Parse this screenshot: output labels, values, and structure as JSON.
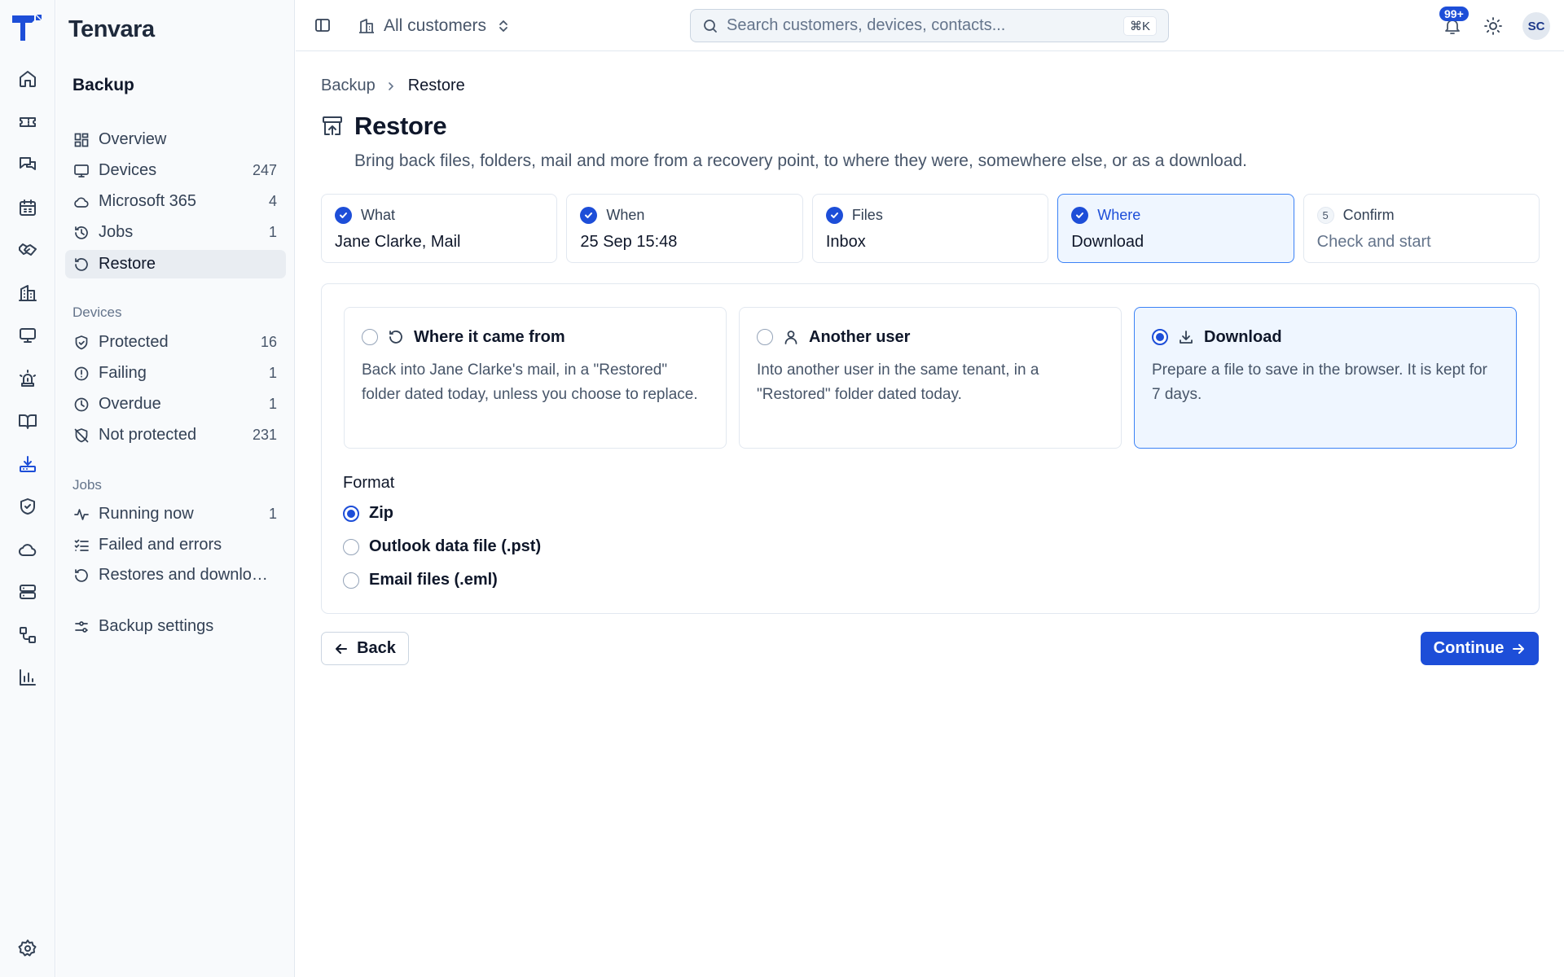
{
  "app": {
    "name": "Tenvara"
  },
  "topbar": {
    "customer_selector": "All customers",
    "search_placeholder": "Search customers, devices, contacts...",
    "search_shortcut": "⌘K",
    "notifications_badge": "99+",
    "avatar_initials": "SC"
  },
  "sidebar": {
    "title": "Backup",
    "items": [
      {
        "label": "Overview",
        "count": "",
        "icon": "overview-icon"
      },
      {
        "label": "Devices",
        "count": "247",
        "icon": "monitor-icon"
      },
      {
        "label": "Microsoft 365",
        "count": "4",
        "icon": "cloud-icon"
      },
      {
        "label": "Jobs",
        "count": "1",
        "icon": "history-icon"
      },
      {
        "label": "Restore",
        "count": "",
        "icon": "restore-icon",
        "active": true
      }
    ],
    "devices_section": {
      "label": "Devices",
      "items": [
        {
          "label": "Protected",
          "count": "16",
          "icon": "shield-check-icon"
        },
        {
          "label": "Failing",
          "count": "1",
          "icon": "alert-circle-icon"
        },
        {
          "label": "Overdue",
          "count": "1",
          "icon": "clock-icon"
        },
        {
          "label": "Not protected",
          "count": "231",
          "icon": "shield-off-icon"
        }
      ]
    },
    "jobs_section": {
      "label": "Jobs",
      "items": [
        {
          "label": "Running now",
          "count": "1",
          "icon": "activity-icon"
        },
        {
          "label": "Failed and errors",
          "count": "",
          "icon": "list-checks-icon"
        },
        {
          "label": "Restores and downloads",
          "count": "",
          "icon": "restore-icon"
        }
      ]
    },
    "settings": {
      "label": "Backup settings",
      "icon": "settings-sliders-icon"
    }
  },
  "breadcrumb": {
    "parent": "Backup",
    "current": "Restore"
  },
  "page": {
    "title": "Restore",
    "description": "Bring back files, folders, mail and more from a recovery point, to where they were, somewhere else, or as a download."
  },
  "steps": [
    {
      "label": "What",
      "value": "Jane Clarke, Mail",
      "state": "done"
    },
    {
      "label": "When",
      "value": "25 Sep 15:48",
      "state": "done"
    },
    {
      "label": "Files",
      "value": "Inbox",
      "state": "done"
    },
    {
      "label": "Where",
      "value": "Download",
      "state": "current"
    },
    {
      "label": "Confirm",
      "value": "Check and start",
      "state": "pending",
      "number": "5"
    }
  ],
  "destinations": [
    {
      "title": "Where it came from",
      "description": "Back into Jane Clarke's mail, in a \"Restored\" folder dated today, unless you choose to replace.",
      "selected": false,
      "icon": "restore-icon"
    },
    {
      "title": "Another user",
      "description": "Into another user in the same tenant, in a \"Restored\" folder dated today.",
      "selected": false,
      "icon": "user-icon"
    },
    {
      "title": "Download",
      "description": "Prepare a file to save in the browser. It is kept for 7 days.",
      "selected": true,
      "icon": "download-icon"
    }
  ],
  "format": {
    "label": "Format",
    "options": [
      {
        "label": "Zip",
        "selected": true
      },
      {
        "label": "Outlook data file (.pst)",
        "selected": false
      },
      {
        "label": "Email files (.eml)",
        "selected": false
      }
    ]
  },
  "actions": {
    "back": "Back",
    "continue": "Continue"
  },
  "colors": {
    "accent": "#1d4ed8",
    "selected_bg": "#eff6ff",
    "sidebar_bg": "#f8fafc"
  }
}
